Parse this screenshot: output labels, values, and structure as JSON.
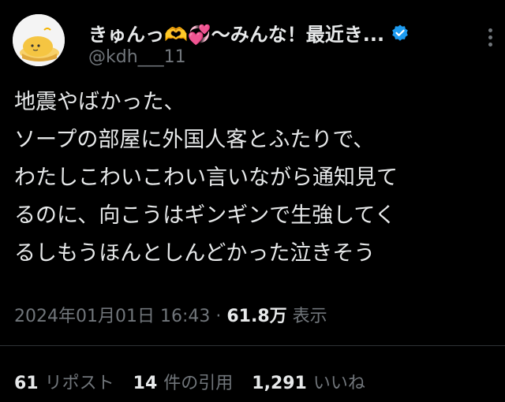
{
  "user": {
    "display_name": "きゅんっ🫶💞〜みんな！最近き...",
    "handle": "@kdh___11",
    "verified": true
  },
  "tweet": {
    "lines": [
      "地震やばかった、",
      "ソープの部屋に外国人客とふたりで、",
      "わたしこわいこわい言いながら通知見て",
      "るのに、向こうはギンギンで生強してく",
      "るしもうほんとしんどかった泣きそう"
    ]
  },
  "meta": {
    "timestamp": "2024年01月01日 16:43",
    "separator": "·",
    "views_count": "61.8万",
    "views_label": "表示"
  },
  "stats": {
    "reposts_count": "61",
    "reposts_label": "リポスト",
    "quotes_count": "14",
    "quotes_label": "件の引用",
    "likes_count": "1,291",
    "likes_label": "いいね"
  },
  "colors": {
    "background": "#000000",
    "text_primary": "#e7e9ea",
    "text_secondary": "#71767b",
    "verified": "#1d9bf0",
    "divider": "#2f3336"
  },
  "icons": {
    "verified": "verified-badge-icon",
    "more": "more-icon"
  }
}
